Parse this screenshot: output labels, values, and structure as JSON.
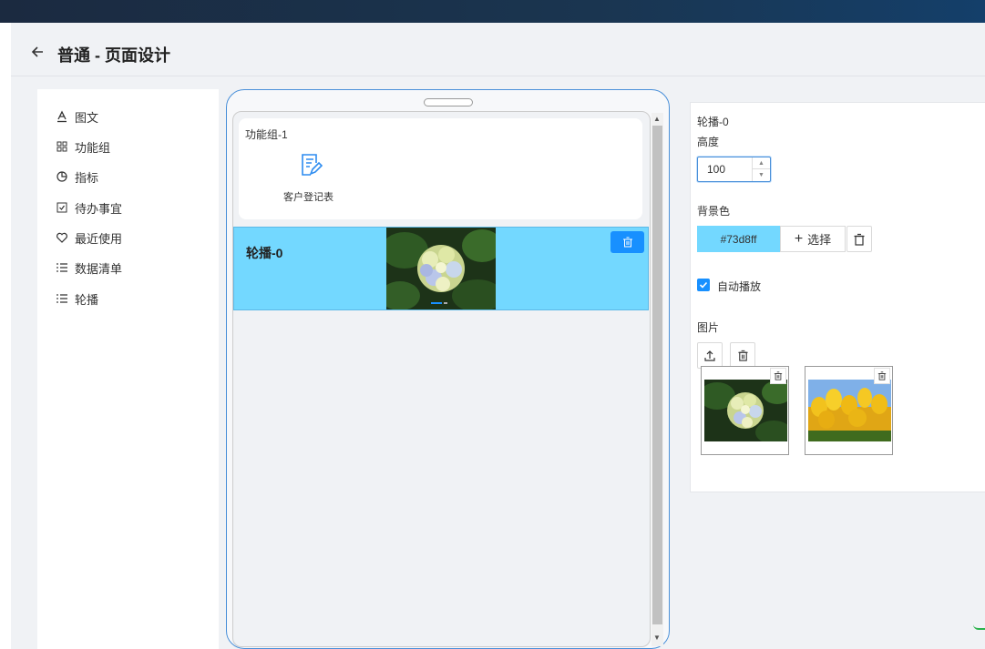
{
  "header": {
    "title": "普通 - 页面设计"
  },
  "palette": {
    "items": [
      {
        "label": "图文",
        "icon": "text-format-icon"
      },
      {
        "label": "功能组",
        "icon": "grid-icon"
      },
      {
        "label": "指标",
        "icon": "pie-chart-icon"
      },
      {
        "label": "待办事宜",
        "icon": "checkbox-icon"
      },
      {
        "label": "最近使用",
        "icon": "heart-icon"
      },
      {
        "label": "数据清单",
        "icon": "list-icon"
      },
      {
        "label": "轮播",
        "icon": "list-icon"
      }
    ]
  },
  "preview": {
    "func_group": {
      "title": "功能组-1",
      "item_label": "客户登记表"
    },
    "carousel": {
      "title": "轮播-0",
      "background": "#73d8ff"
    }
  },
  "props": {
    "component_name": "轮播-0",
    "height_label": "高度",
    "height_value": "100",
    "bg_label": "背景色",
    "bg_value": "#73d8ff",
    "select_label": "选择",
    "autoplay_label": "自动播放",
    "autoplay_checked": true,
    "images_label": "图片"
  },
  "colors": {
    "accent": "#1890ff",
    "carousel_bg": "#73d8ff",
    "phone_border": "#4a90d9"
  }
}
